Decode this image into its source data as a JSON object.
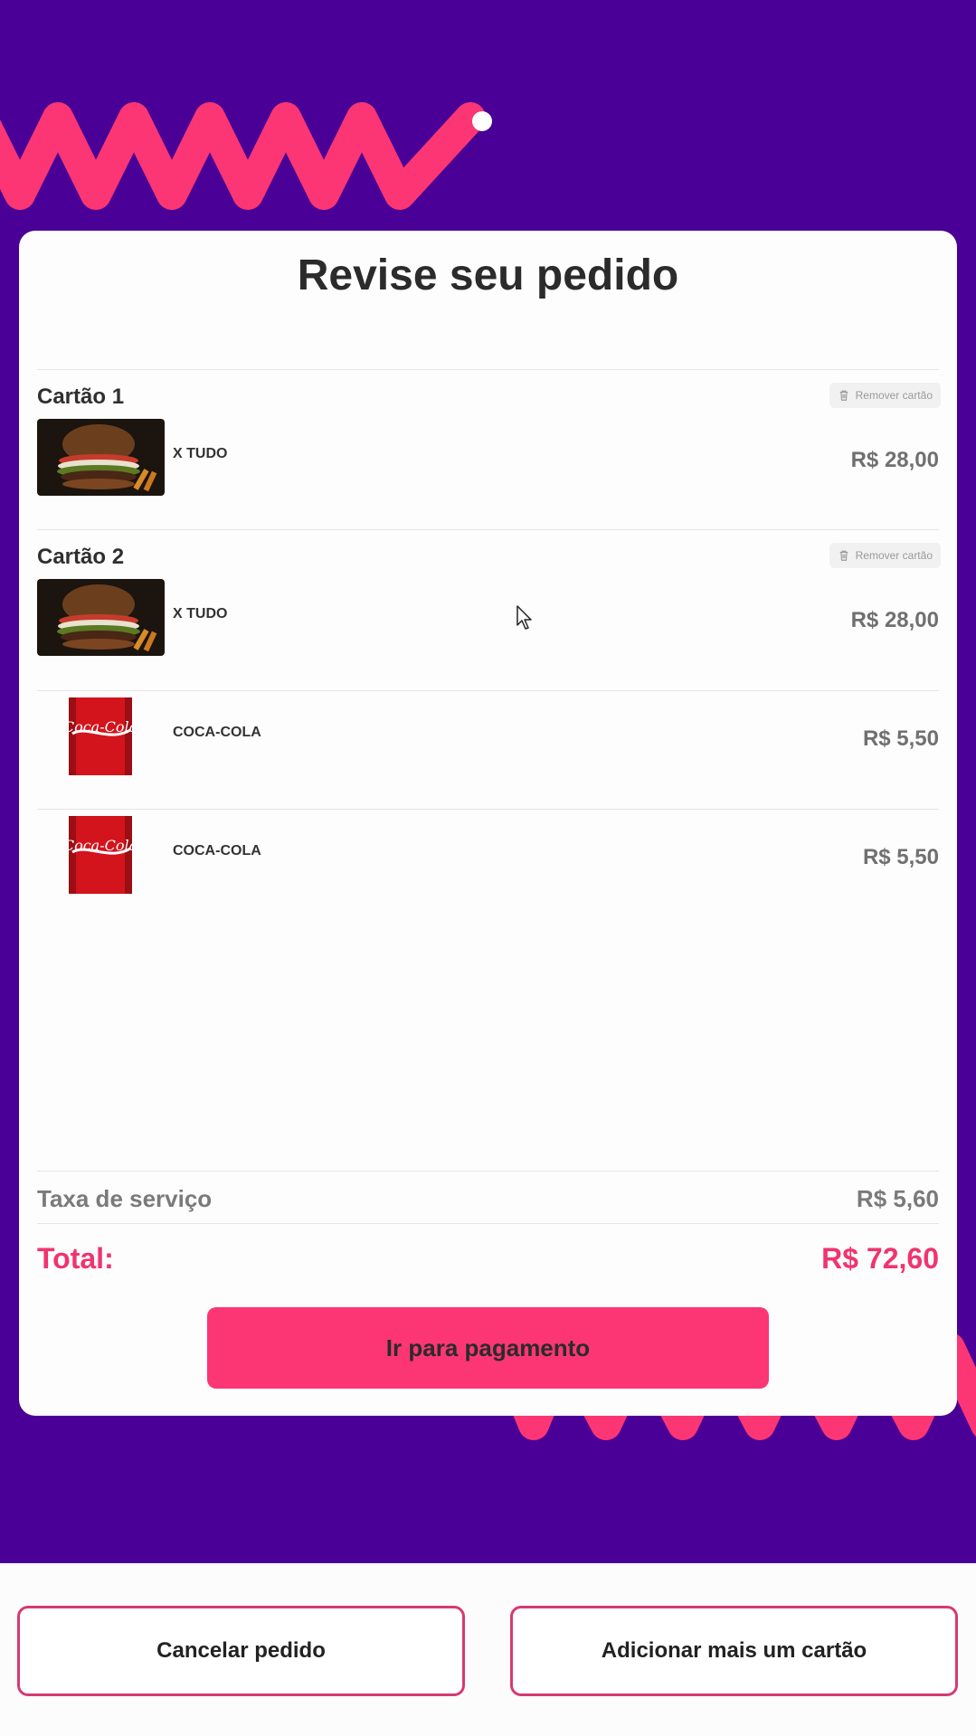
{
  "card": {
    "title": "Revise seu pedido",
    "cards": [
      {
        "label": "Cartão 1",
        "remove_label": "Remover cartão",
        "items": [
          {
            "name": "X TUDO",
            "price": "R$ 28,00",
            "icon": "burger-image"
          }
        ]
      },
      {
        "label": "Cartão 2",
        "remove_label": "Remover cartão",
        "items": [
          {
            "name": "X TUDO",
            "price": "R$ 28,00",
            "icon": "burger-image"
          },
          {
            "name": "COCA-COLA",
            "price": "R$ 5,50",
            "icon": "coca-cola-can-image"
          },
          {
            "name": "COCA-COLA",
            "price": "R$ 5,50",
            "icon": "coca-cola-can-image"
          }
        ]
      }
    ],
    "service_fee_label": "Taxa de serviço",
    "service_fee_value": "R$ 5,60",
    "total_label": "Total:",
    "total_value": "R$ 72,60",
    "pay_button": "Ir para pagamento"
  },
  "footer": {
    "cancel_button": "Cancelar pedido",
    "add_card_button": "Adicionar mais um cartão"
  },
  "colors": {
    "background": "#4a0096",
    "accent": "#fc3674",
    "total": "#f0346f"
  }
}
